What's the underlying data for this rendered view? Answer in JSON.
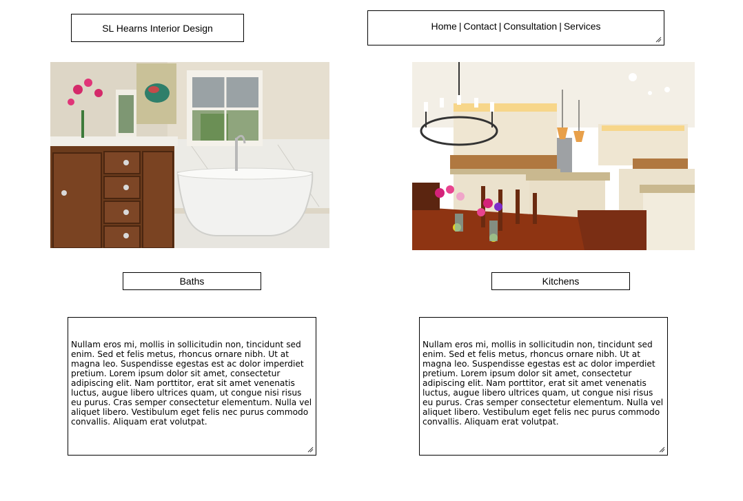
{
  "header": {
    "brand": "SL Hearns Interior Design"
  },
  "nav": {
    "items": [
      "Home",
      "Contact",
      "Consultation",
      "Services"
    ],
    "separator": "|"
  },
  "sections": [
    {
      "label": "Baths",
      "image": "bathroom-photo",
      "text": "Nullam eros mi, mollis in sollicitudin non, tincidunt sed enim. Sed et felis metus, rhoncus ornare nibh. Ut at magna leo. Suspendisse egestas est ac dolor imperdiet pretium. Lorem ipsum dolor sit amet, consectetur adipiscing elit. Nam porttitor, erat sit amet venenatis luctus, augue libero ultrices quam, ut congue nisi risus eu purus. Cras semper consectetur elementum. Nulla vel aliquet libero. Vestibulum eget felis nec purus commodo convallis. Aliquam erat volutpat."
    },
    {
      "label": "Kitchens",
      "image": "kitchen-photo",
      "text": "Nullam eros mi, mollis in sollicitudin non, tincidunt sed enim. Sed et felis metus, rhoncus ornare nibh. Ut at magna leo. Suspendisse egestas est ac dolor imperdiet pretium. Lorem ipsum dolor sit amet, consectetur adipiscing elit. Nam porttitor, erat sit amet venenatis luctus, augue libero ultrices quam, ut congue nisi risus eu purus. Cras semper consectetur elementum. Nulla vel aliquet libero. Vestibulum eget felis nec purus commodo convallis. Aliquam erat volutpat."
    }
  ],
  "colors": {
    "border": "#000000",
    "background": "#ffffff",
    "wood": "#6b3b1c",
    "tub": "#f2f2f0"
  }
}
